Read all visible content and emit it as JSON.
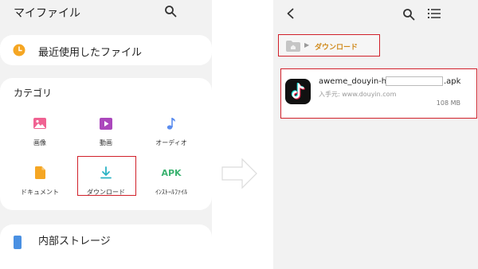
{
  "left": {
    "title": "マイファイル",
    "recent_label": "最近使用したファイル",
    "category_title": "カテゴリ",
    "categories": [
      {
        "label": "画像",
        "icon": "image-icon"
      },
      {
        "label": "動画",
        "icon": "video-icon"
      },
      {
        "label": "オーディオ",
        "icon": "music-note-icon"
      },
      {
        "label": "ドキュメント",
        "icon": "document-icon"
      },
      {
        "label": "ダウンロード",
        "icon": "download-icon"
      },
      {
        "label": "APK",
        "sublabel": "ｲﾝｽﾄｰﾙﾌｧｲﾙ",
        "icon": "apk-icon"
      }
    ],
    "storage_label": "内部ストレージ"
  },
  "right": {
    "breadcrumb_label": "ダウンロード",
    "file": {
      "name_start": "aweme_douyin-h",
      "name_end": ".apk",
      "source": "入手元: www.douyin.com",
      "size": "108 MB"
    }
  },
  "colors": {
    "highlight": "#d1202a",
    "accent_orange": "#f5a623",
    "accent_green": "#3cb371",
    "breadcrumb_text": "#d08a1c",
    "icon_pink": "#f06292",
    "icon_purple": "#ab47bc",
    "icon_blue": "#5b8def",
    "icon_teal": "#2ab3c4"
  }
}
